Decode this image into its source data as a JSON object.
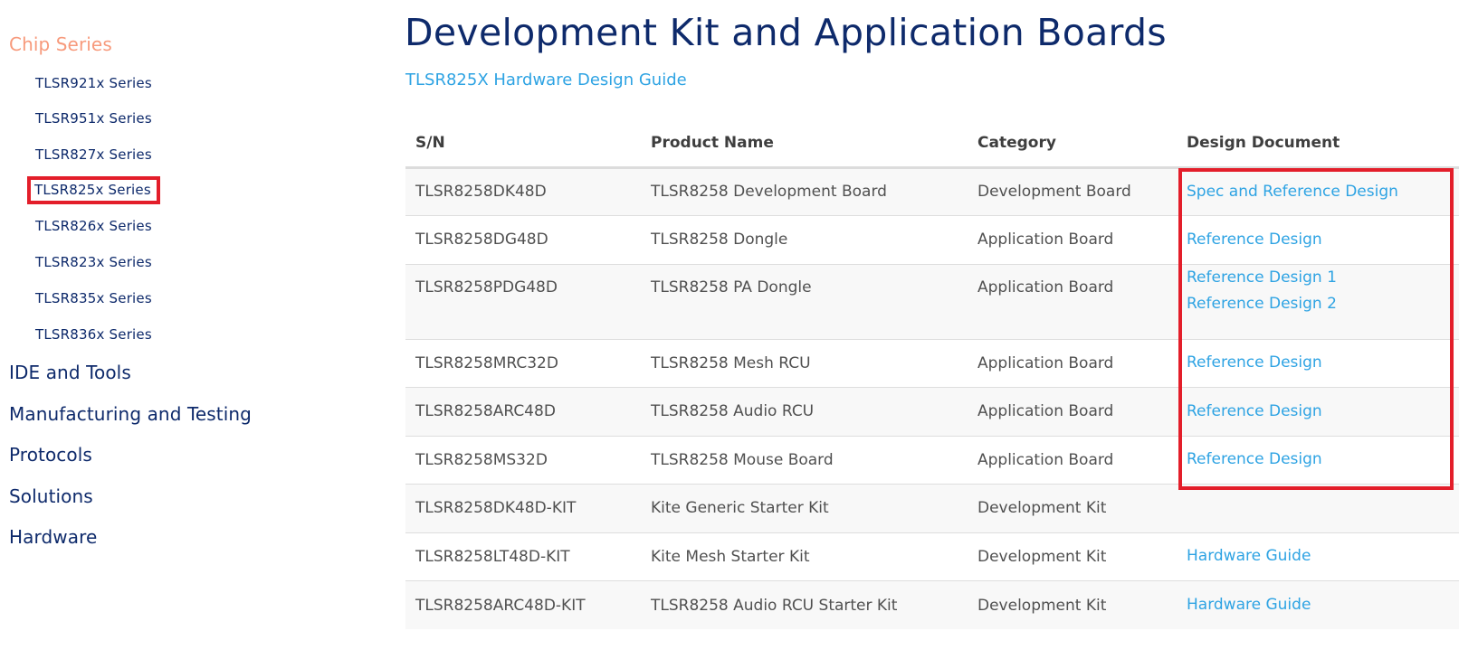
{
  "sidebar": {
    "active_section": "Chip Series",
    "chip_series": [
      {
        "label": "TLSR921x Series",
        "highlighted": false
      },
      {
        "label": "TLSR951x Series",
        "highlighted": false
      },
      {
        "label": "TLSR827x Series",
        "highlighted": false
      },
      {
        "label": "TLSR825x Series",
        "highlighted": true
      },
      {
        "label": "TLSR826x Series",
        "highlighted": false
      },
      {
        "label": "TLSR823x Series",
        "highlighted": false
      },
      {
        "label": "TLSR835x Series",
        "highlighted": false
      },
      {
        "label": "TLSR836x Series",
        "highlighted": false
      }
    ],
    "sections": [
      {
        "label": "IDE and Tools"
      },
      {
        "label": "Manufacturing and Testing"
      },
      {
        "label": "Protocols"
      },
      {
        "label": "Solutions"
      },
      {
        "label": "Hardware"
      }
    ]
  },
  "main": {
    "title": "Development Kit and Application Boards",
    "guide_link": "TLSR825X Hardware Design Guide",
    "table": {
      "headers": [
        "S/N",
        "Product Name",
        "Category",
        "Design Document"
      ],
      "rows": [
        {
          "sn": "TLSR8258DK48D",
          "product": "TLSR8258 Development Board",
          "category": "Development Board",
          "docs": [
            "Spec and Reference Design"
          ]
        },
        {
          "sn": "TLSR8258DG48D",
          "product": "TLSR8258 Dongle",
          "category": "Application Board",
          "docs": [
            "Reference Design"
          ]
        },
        {
          "sn": "TLSR8258PDG48D",
          "product": "TLSR8258 PA Dongle",
          "category": "Application Board",
          "docs": [
            "Reference Design 1",
            "Reference Design 2"
          ]
        },
        {
          "sn": "TLSR8258MRC32D",
          "product": "TLSR8258 Mesh RCU",
          "category": "Application Board",
          "docs": [
            "Reference Design"
          ]
        },
        {
          "sn": "TLSR8258ARC48D",
          "product": "TLSR8258 Audio RCU",
          "category": "Application Board",
          "docs": [
            "Reference Design"
          ]
        },
        {
          "sn": "TLSR8258MS32D",
          "product": "TLSR8258 Mouse Board",
          "category": "Application Board",
          "docs": [
            "Reference Design"
          ]
        },
        {
          "sn": "TLSR8258DK48D-KIT",
          "product": "Kite Generic Starter Kit",
          "category": "Development Kit",
          "docs": []
        },
        {
          "sn": "TLSR8258LT48D-KIT",
          "product": "Kite Mesh Starter Kit",
          "category": "Development Kit",
          "docs": [
            "Hardware Guide"
          ]
        },
        {
          "sn": "TLSR8258ARC48D-KIT",
          "product": "TLSR8258 Audio RCU Starter Kit",
          "category": "Development Kit",
          "docs": [
            "Hardware Guide"
          ]
        }
      ]
    }
  },
  "annotations": {
    "highlight_color": "#e31e2a",
    "highlighted_targets": [
      "sidebar TLSR825x Series",
      "Design Document column rows 1-6"
    ]
  },
  "colors": {
    "nav_text": "#0e2a6b",
    "active_section": "#f79a7c",
    "link": "#2ea3e3",
    "body_text": "#505050",
    "stripe": "#f8f8f8"
  }
}
